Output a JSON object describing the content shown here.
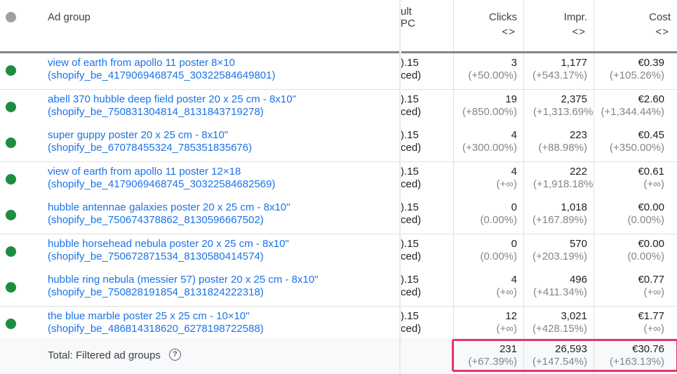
{
  "header": {
    "ad_group_label": "Ad group",
    "frozen_col_label_line1": "ult",
    "frozen_col_label_line2": "PC",
    "columns": [
      {
        "label": "Clicks",
        "sort_icon": "<>"
      },
      {
        "label": "Impr.",
        "sort_icon": "<>"
      },
      {
        "label": "Cost",
        "sort_icon": "<>"
      }
    ]
  },
  "colors": {
    "enabled_status": "#1e8e3e",
    "header_status": "#9aa0a6",
    "link": "#1a73e8",
    "highlight_border": "#e8336d"
  },
  "rows": [
    {
      "name": "view of earth from apollo 11 poster 8×10",
      "id": "(shopify_be_4179069468745_30322584649801)",
      "bid": ").15",
      "bid_type": "ced)",
      "clicks": "3",
      "clicks_change": "(+50.00%)",
      "impr": "1,177",
      "impr_change": "(+543.17%)",
      "cost": "€0.39",
      "cost_change": "(+105.26%)"
    },
    {
      "name": "abell 370 hubble deep field poster 20 x 25 cm - 8x10\"",
      "id": "(shopify_be_750831304814_8131843719278)",
      "bid": ").15",
      "bid_type": "ced)",
      "clicks": "19",
      "clicks_change": "(+850.00%)",
      "impr": "2,375",
      "impr_change": "(+1,313.69%",
      "cost": "€2.60",
      "cost_change": "(+1,344.44%)"
    },
    {
      "name": "super guppy poster 20 x 25 cm - 8x10\"",
      "id": "(shopify_be_67078455324_785351835676)",
      "bid": ").15",
      "bid_type": "ced)",
      "clicks": "4",
      "clicks_change": "(+300.00%)",
      "impr": "223",
      "impr_change": "(+88.98%)",
      "cost": "€0.45",
      "cost_change": "(+350.00%)"
    },
    {
      "name": "view of earth from apollo 11 poster 12×18",
      "id": "(shopify_be_4179069468745_30322584682569)",
      "bid": ").15",
      "bid_type": "ced)",
      "clicks": "4",
      "clicks_change": "(+∞)",
      "impr": "222",
      "impr_change": "(+1,918.18%",
      "cost": "€0.61",
      "cost_change": "(+∞)"
    },
    {
      "name": "hubble antennae galaxies poster 20 x 25 cm - 8x10\"",
      "id": "(shopify_be_750674378862_8130596667502)",
      "bid": ").15",
      "bid_type": "ced)",
      "clicks": "0",
      "clicks_change": "(0.00%)",
      "impr": "1,018",
      "impr_change": "(+167.89%)",
      "cost": "€0.00",
      "cost_change": "(0.00%)"
    },
    {
      "name": "hubble horsehead nebula poster 20 x 25 cm - 8x10\"",
      "id": "(shopify_be_750672871534_8130580414574)",
      "bid": ").15",
      "bid_type": "ced)",
      "clicks": "0",
      "clicks_change": "(0.00%)",
      "impr": "570",
      "impr_change": "(+203.19%)",
      "cost": "€0.00",
      "cost_change": "(0.00%)"
    },
    {
      "name": "hubble ring nebula (messier 57) poster 20 x 25 cm - 8x10\"",
      "id": "(shopify_be_750828191854_8131824222318)",
      "bid": ").15",
      "bid_type": "ced)",
      "clicks": "4",
      "clicks_change": "(+∞)",
      "impr": "496",
      "impr_change": "(+411.34%)",
      "cost": "€0.77",
      "cost_change": "(+∞)"
    },
    {
      "name": "the blue marble poster 25 x 25 cm - 10×10\"",
      "id": "(shopify_be_486814318620_6278198722588)",
      "bid": ").15",
      "bid_type": "ced)",
      "clicks": "12",
      "clicks_change": "(+∞)",
      "impr": "3,021",
      "impr_change": "(+428.15%)",
      "cost": "€1.77",
      "cost_change": "(+∞)"
    }
  ],
  "total": {
    "label": "Total: Filtered ad groups",
    "help_icon": "?",
    "clicks": "231",
    "clicks_change": "(+67.39%)",
    "impr": "26,593",
    "impr_change": "(+147.54%)",
    "cost": "€30.76",
    "cost_change": "(+163.13%)"
  }
}
